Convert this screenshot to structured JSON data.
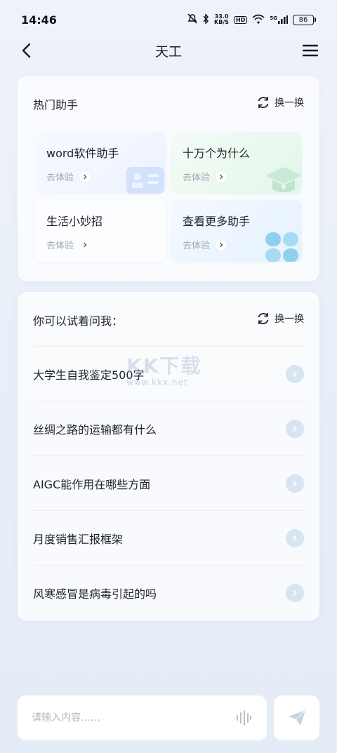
{
  "status_bar": {
    "time": "14:46",
    "net_speed_value": "33.0",
    "net_speed_unit": "KB/S",
    "hd": "HD",
    "signal": "5G",
    "battery": "86"
  },
  "header": {
    "title": "天工",
    "back_icon": "chevron-left-icon",
    "menu_icon": "hamburger-menu-icon"
  },
  "hot_assistants": {
    "title": "热门助手",
    "refresh_label": "换一换",
    "tiles": [
      {
        "title": "word软件助手",
        "action": "去体验"
      },
      {
        "title": "十万个为什么",
        "action": "去体验"
      },
      {
        "title": "生活小妙招",
        "action": "去体验"
      },
      {
        "title": "查看更多助手",
        "action": "去体验"
      }
    ]
  },
  "suggestions": {
    "title": "你可以试着问我：",
    "refresh_label": "换一换",
    "items": [
      "大学生自我鉴定500字",
      "丝绸之路的运输都有什么",
      "AIGC能作用在哪些方面",
      "月度销售汇报框架",
      "风寒感冒是病毒引起的吗"
    ]
  },
  "watermark": {
    "brand": "KK下载",
    "url": "www.kkx.net"
  },
  "composer": {
    "placeholder": "请输入内容……",
    "voice_icon": "voice-wave-icon",
    "send_icon": "paper-plane-icon"
  },
  "colors": {
    "accent": "#c9d9ea",
    "arrow_bg": "#d7e4f1",
    "text_primary": "#1f2329",
    "text_secondary": "#a2a8b3"
  }
}
